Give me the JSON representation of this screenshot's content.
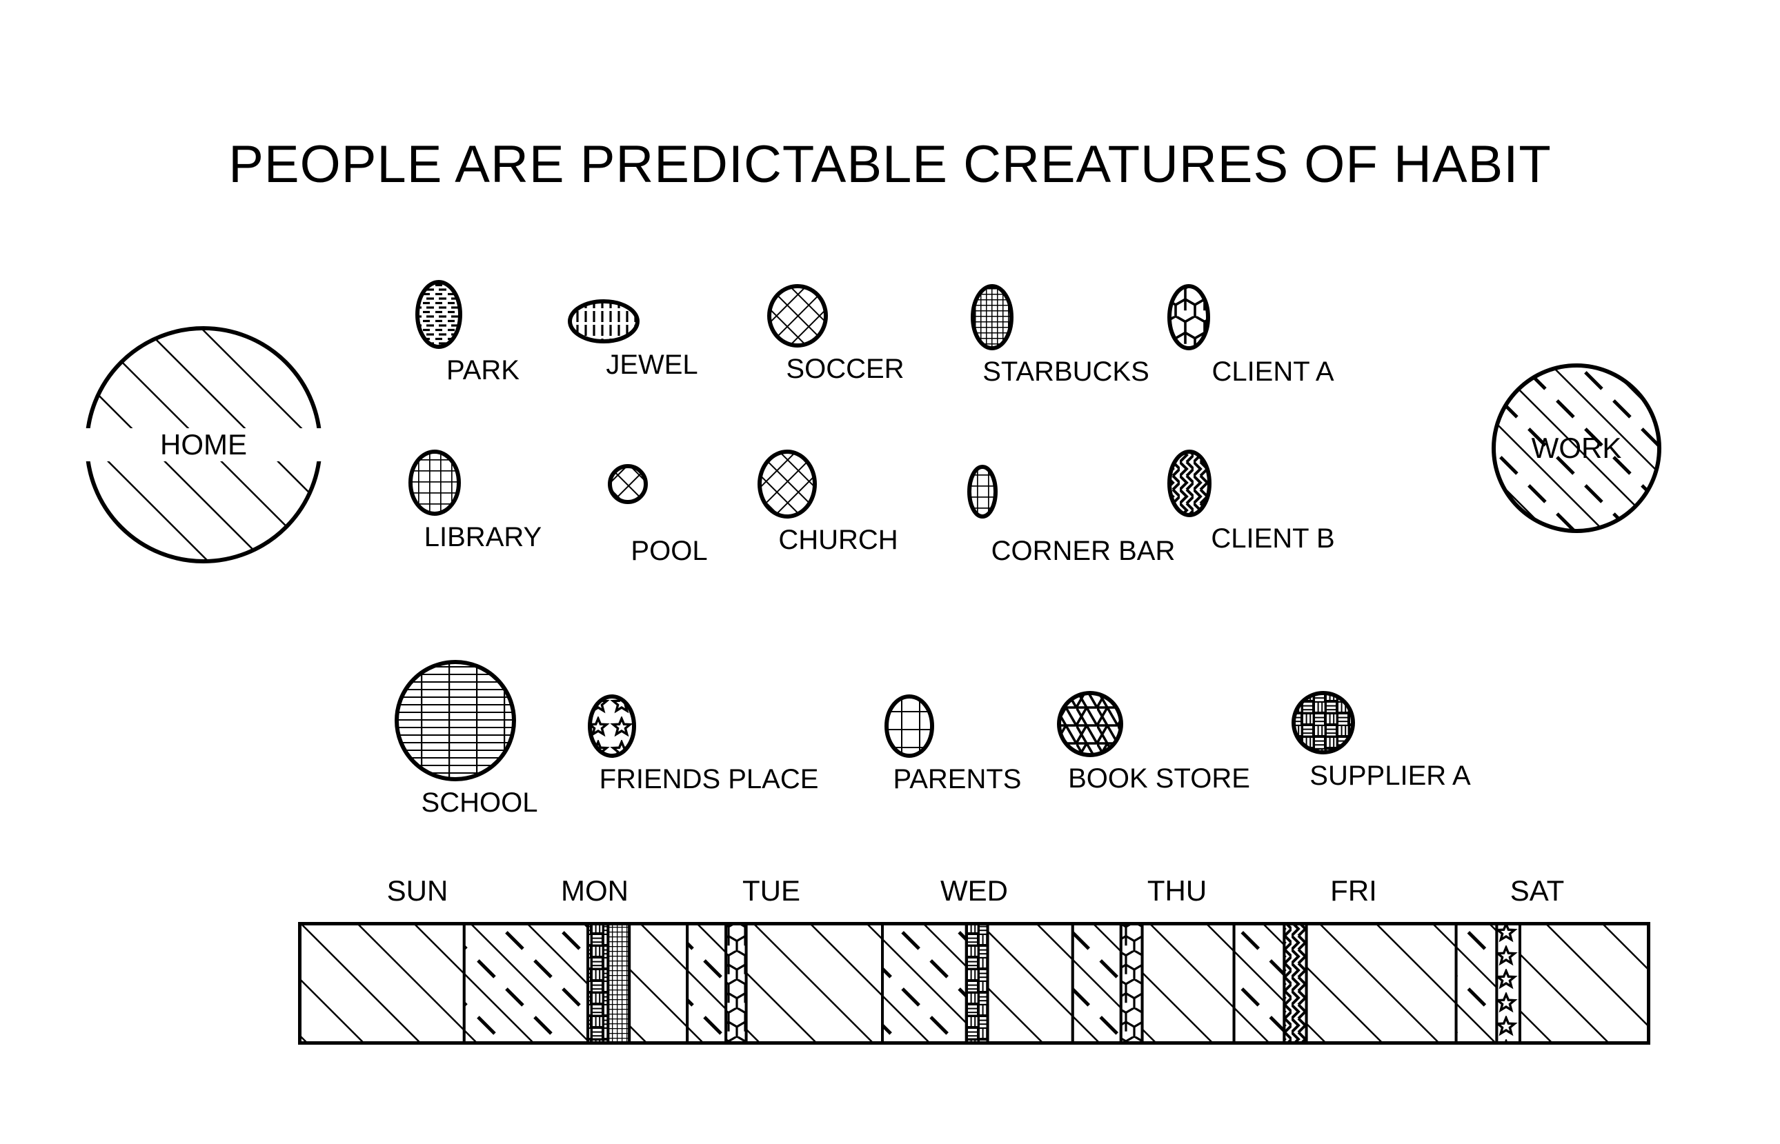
{
  "title": "PEOPLE ARE PREDICTABLE CREATURES OF HABIT",
  "anchors": {
    "home": {
      "label": "HOME",
      "pattern": "diagonal-hatch-solid"
    },
    "work": {
      "label": "WORK",
      "pattern": "diagonal-hatch-dashed"
    }
  },
  "rows": [
    {
      "row": 1,
      "nodes": [
        {
          "label": "PARK",
          "pattern": "brick-dash",
          "shape": "ellipse-tall"
        },
        {
          "label": "JEWEL",
          "pattern": "vertical-dash",
          "shape": "ellipse-wide"
        },
        {
          "label": "SOCCER",
          "pattern": "diagonal-crosshatch",
          "shape": "circle"
        },
        {
          "label": "STARBUCKS",
          "pattern": "fine-grid",
          "shape": "ellipse-tall"
        },
        {
          "label": "CLIENT A",
          "pattern": "honeycomb",
          "shape": "ellipse-tall"
        }
      ]
    },
    {
      "row": 2,
      "nodes": [
        {
          "label": "LIBRARY",
          "pattern": "square-grid",
          "shape": "ellipse-tall"
        },
        {
          "label": "POOL",
          "pattern": "diagonal-crosshatch",
          "shape": "circle-small"
        },
        {
          "label": "CHURCH",
          "pattern": "diagonal-crosshatch",
          "shape": "ellipse-tall"
        },
        {
          "label": "CORNER BAR",
          "pattern": "square-grid",
          "shape": "ellipse-narrow"
        },
        {
          "label": "CLIENT B",
          "pattern": "zigzag",
          "shape": "ellipse-tall"
        }
      ]
    },
    {
      "row": 3,
      "nodes": [
        {
          "label": "SCHOOL",
          "pattern": "dense-horizontal-grid",
          "shape": "circle-large"
        },
        {
          "label": "FRIENDS PLACE",
          "pattern": "stars",
          "shape": "ellipse-tall"
        },
        {
          "label": "PARENTS",
          "pattern": "coarse-grid",
          "shape": "ellipse-tall"
        },
        {
          "label": "BOOK STORE",
          "pattern": "triangle-mesh",
          "shape": "circle"
        },
        {
          "label": "SUPPLIER A",
          "pattern": "basketweave",
          "shape": "circle"
        }
      ]
    }
  ],
  "timeline": {
    "days": [
      "SUN",
      "MON",
      "TUE",
      "WED",
      "THU",
      "FRI",
      "SAT"
    ],
    "segments": [
      {
        "activity": "HOME",
        "pattern": "diagonal-hatch-solid",
        "start": 0,
        "end": 0.172
      },
      {
        "activity": "WORK",
        "pattern": "diagonal-hatch-dashed",
        "start": 0.172,
        "end": 0.3
      },
      {
        "activity": "SUPPLIER A",
        "pattern": "basketweave",
        "start": 0.3,
        "end": 0.321
      },
      {
        "activity": "STARBUCKS",
        "pattern": "fine-grid",
        "start": 0.321,
        "end": 0.343
      },
      {
        "activity": "HOME",
        "pattern": "diagonal-hatch-solid",
        "start": 0.343,
        "end": 0.403
      },
      {
        "activity": "WORK",
        "pattern": "diagonal-hatch-dashed",
        "start": 0.403,
        "end": 0.443
      },
      {
        "activity": "CLIENT A",
        "pattern": "honeycomb",
        "start": 0.443,
        "end": 0.464
      },
      {
        "activity": "HOME",
        "pattern": "diagonal-hatch-solid",
        "start": 0.464,
        "end": 0.605
      },
      {
        "activity": "WORK",
        "pattern": "diagonal-hatch-dashed",
        "start": 0.605,
        "end": 0.692
      },
      {
        "activity": "SUPPLIER A",
        "pattern": "basketweave",
        "start": 0.692,
        "end": 0.714
      },
      {
        "activity": "HOME",
        "pattern": "diagonal-hatch-solid",
        "start": 0.714,
        "end": 0.802
      },
      {
        "activity": "WORK",
        "pattern": "diagonal-hatch-dashed",
        "start": 0.802,
        "end": 0.852
      },
      {
        "activity": "CLIENT A",
        "pattern": "honeycomb",
        "start": 0.852,
        "end": 0.874
      },
      {
        "activity": "HOME",
        "pattern": "diagonal-hatch-solid",
        "start": 0.874,
        "end": 0.969
      },
      {
        "activity": "WORK",
        "pattern": "diagonal-hatch-dashed",
        "start": 0.969,
        "end": 1.021
      },
      {
        "activity": "CLIENT B",
        "pattern": "zigzag",
        "start": 1.021,
        "end": 1.044
      },
      {
        "activity": "HOME",
        "pattern": "diagonal-hatch-solid",
        "start": 1.044,
        "end": 1.199
      },
      {
        "activity": "WORK",
        "pattern": "diagonal-hatch-dashed",
        "start": 1.199,
        "end": 1.241
      },
      {
        "activity": "FRIENDS PLACE",
        "pattern": "stars",
        "start": 1.241,
        "end": 1.265
      },
      {
        "activity": "HOME",
        "pattern": "diagonal-hatch-solid",
        "start": 1.265,
        "end": 1.4
      }
    ]
  },
  "colors": {
    "ink": "#000000",
    "paper": "#ffffff"
  }
}
